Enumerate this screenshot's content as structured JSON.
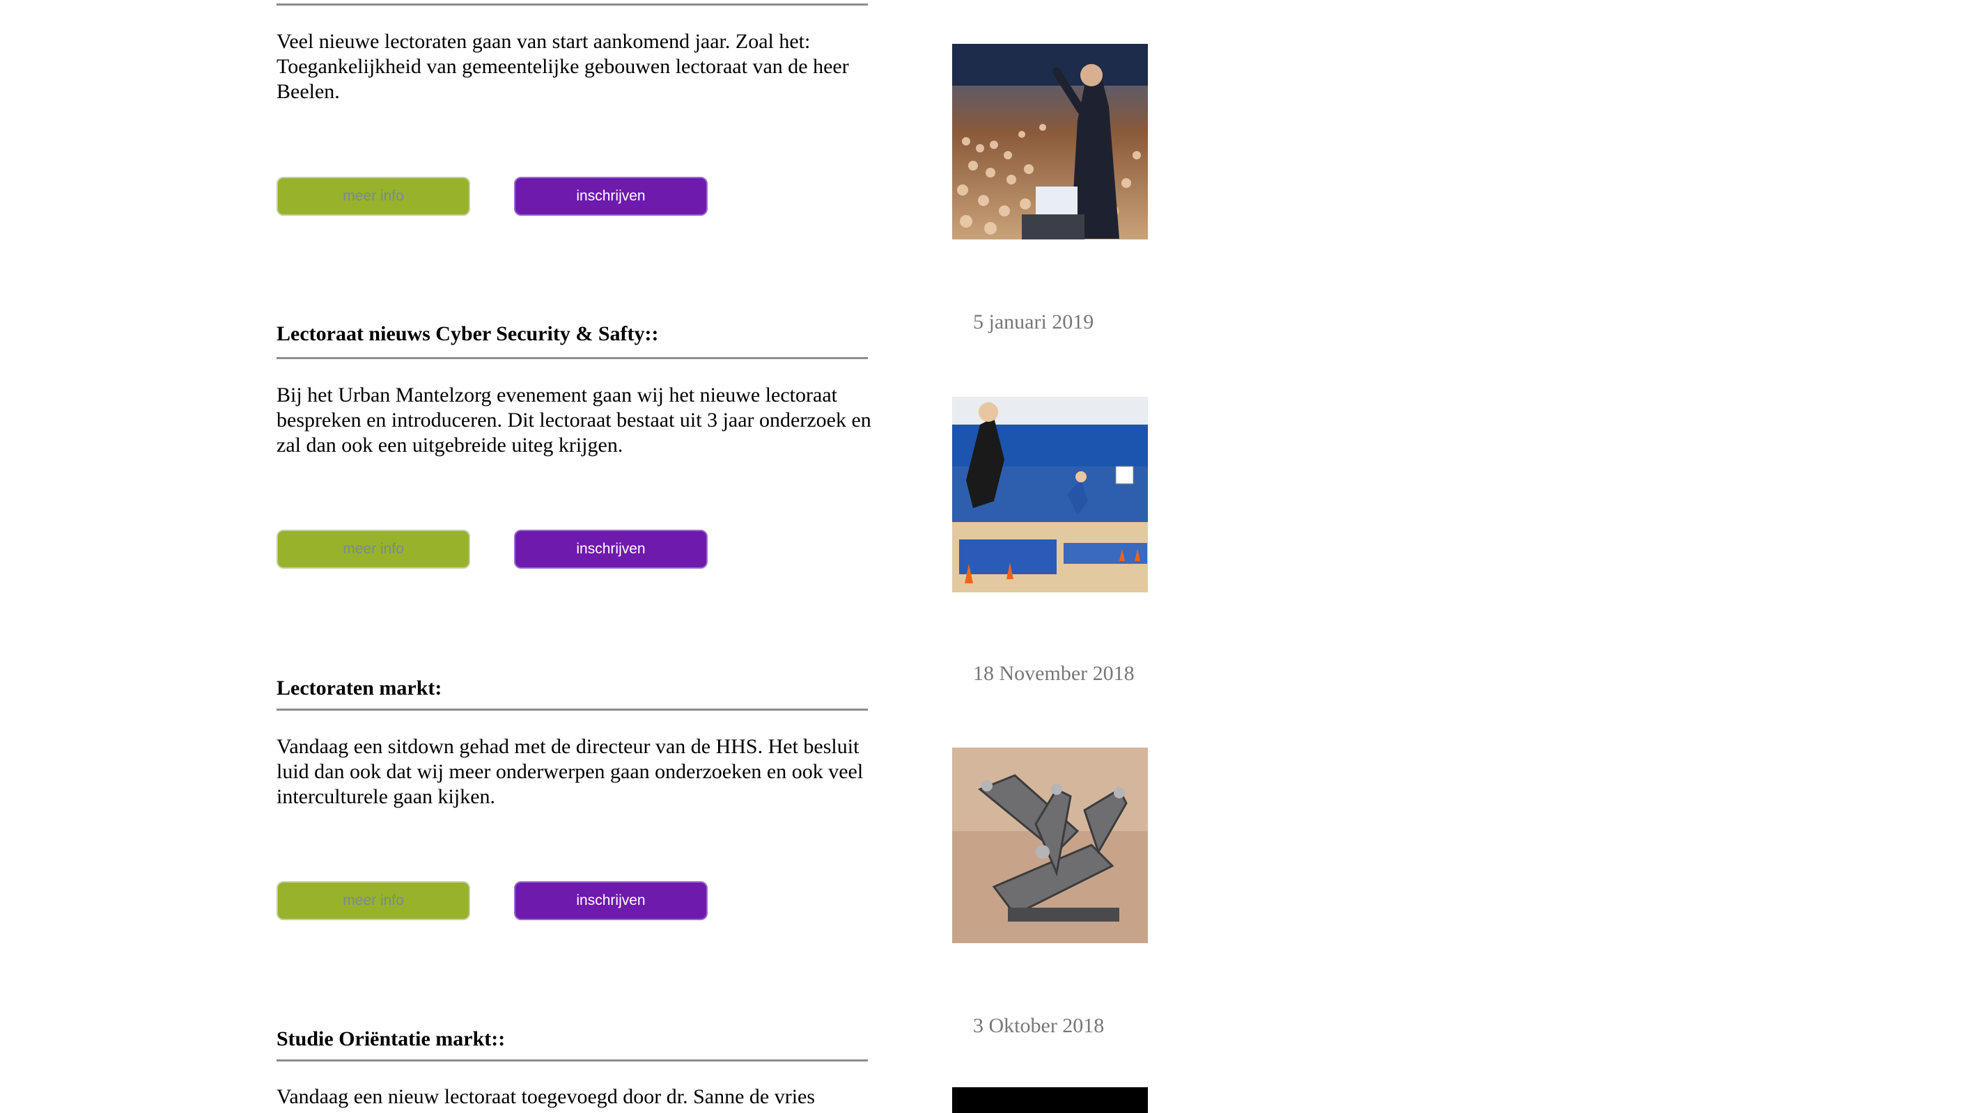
{
  "buttons": {
    "info_label": "meer info",
    "signup_label": "inschrijven"
  },
  "articles": [
    {
      "title": "",
      "body": "Veel nieuwe lectoraten gaan van start aankomend jaar. Zoal het: Toegankelijkheid van gemeentelijke gebouwen lectoraat van de heer Beelen.",
      "image": "conference-audience-photo"
    },
    {
      "title": "Lectoraat nieuws Cyber Security & Safty::",
      "date": "5 januari 2019",
      "body": "Bij het Urban Mantelzorg evenement gaan wij het nieuwe lectoraat bespreken en introduceren. Dit lectoraat bestaat uit 3 jaar onderzoek en zal dan ook een uitgebreide uiteg krijgen.",
      "image": "sports-hall-photo"
    },
    {
      "title": "Lectoraten markt:",
      "date": "18 November 2018",
      "body": "Vandaag een sitdown gehad met de directeur van de HHS. Het besluit luid dan ook dat wij meer onderwerpen gaan onderzoeken en ook veel interculturele gaan kijken.",
      "image": "metal-sculpture-photo"
    },
    {
      "title": "Studie Oriëntatie markt::",
      "date": "3 Oktober 2018",
      "body": "Vandaag een nieuw lectoraat toegevoegd door dr. Sanne de vries",
      "image": "dark-photo"
    }
  ]
}
